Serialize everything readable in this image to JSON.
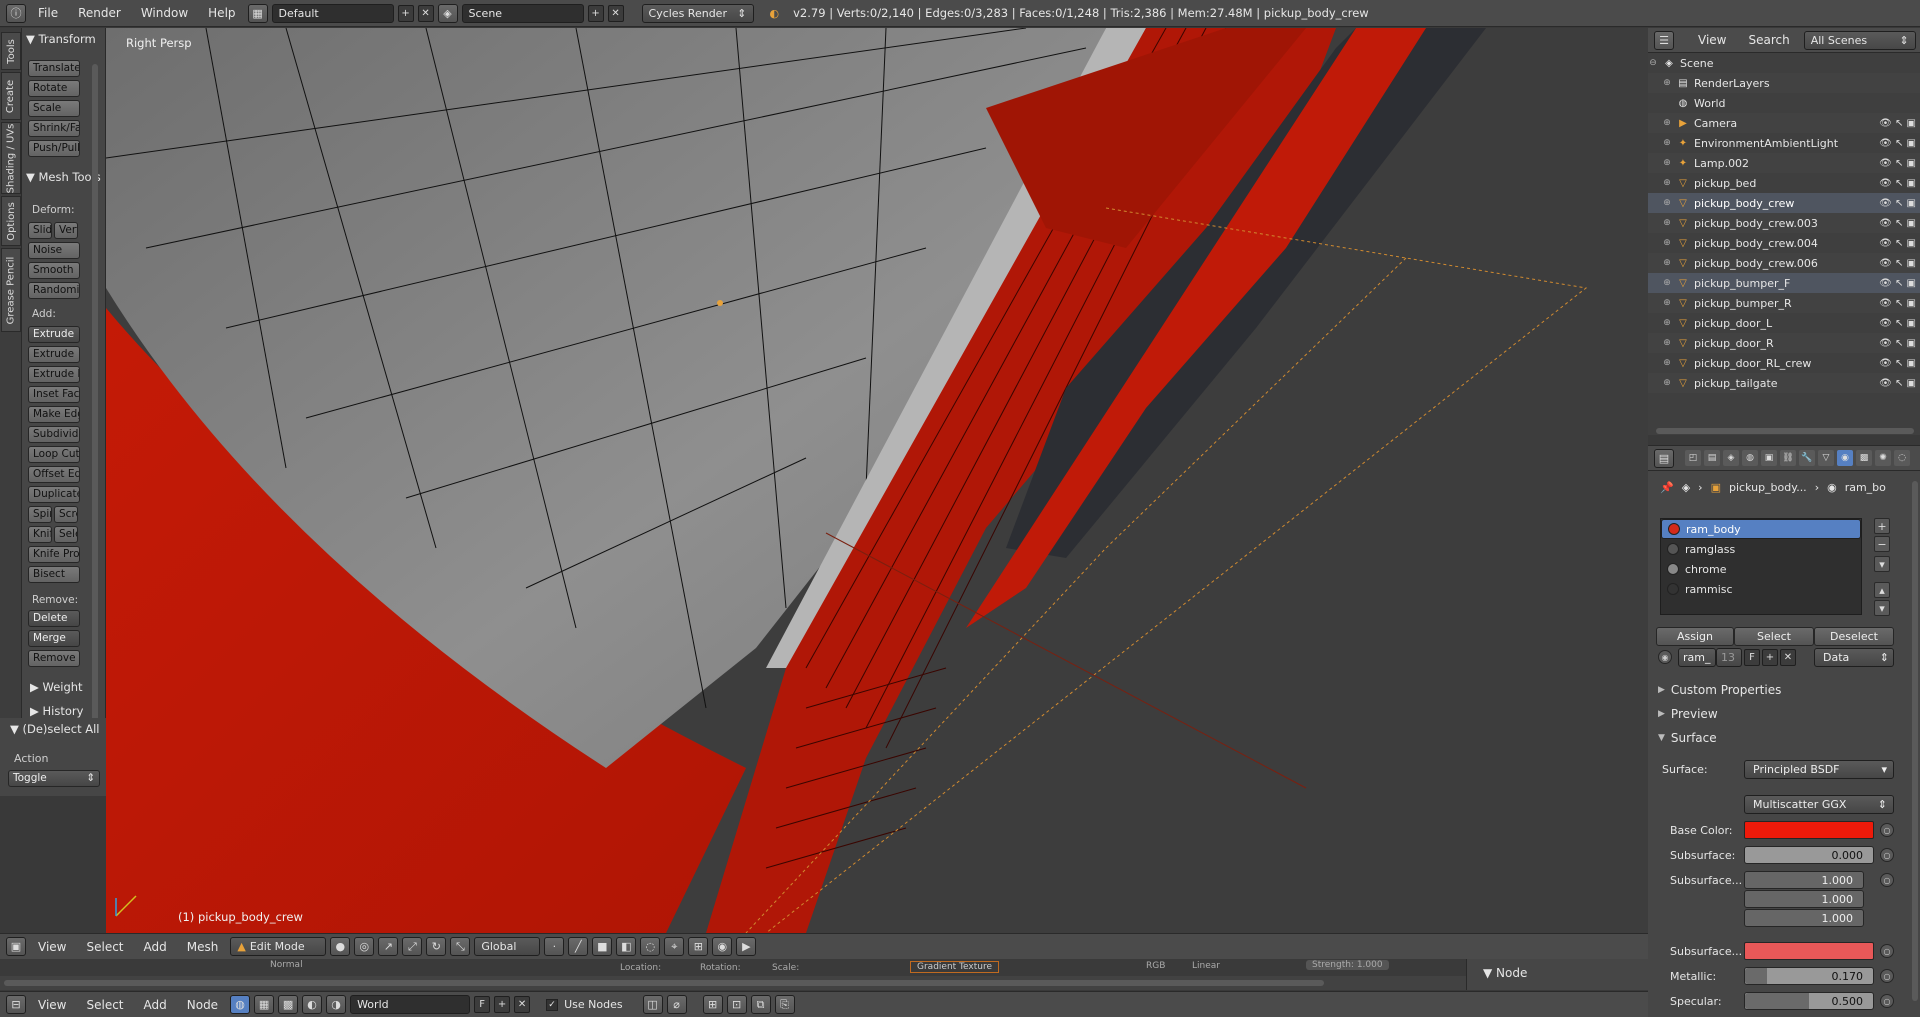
{
  "topbar": {
    "menus": [
      "File",
      "Render",
      "Window",
      "Help"
    ],
    "layout": "Default",
    "scene": "Scene",
    "engine": "Cycles Render",
    "stats": "v2.79 | Verts:0/2,140 | Edges:0/3,283 | Faces:0/1,248 | Tris:2,386 | Mem:27.48M | pickup_body_crew"
  },
  "tabs": [
    "Tools",
    "Create",
    "Shading / UVs",
    "Options",
    "Grease Pencil"
  ],
  "toolshelf": {
    "transform_header": "Transform",
    "transform_buttons": [
      "Translate",
      "Rotate",
      "Scale",
      "Shrink/Fatten",
      "Push/Pull"
    ],
    "meshtools_header": "Mesh Tools",
    "deform_label": "Deform:",
    "deform_buttons": [
      "Slide",
      "Vertex",
      "Noise",
      "Smooth",
      "Randomize"
    ],
    "add_label": "Add:",
    "add_buttons": [
      "Extrude",
      "Extrude",
      "Extrude Individual",
      "Inset Faces",
      "Make Edge/Face",
      "Subdivide",
      "Loop Cut and Slide",
      "Offset Edge Slide",
      "Duplicate",
      "Spin",
      "Screw",
      "Knife",
      "Select",
      "Knife Project",
      "Bisect"
    ],
    "remove_label": "Remove:",
    "remove_buttons": [
      "Delete",
      "Merge",
      "Remove"
    ],
    "weight_header": "Weight",
    "history_header": "History"
  },
  "operator_panel": {
    "header": "(De)select All",
    "action_label": "Action",
    "action_value": "Toggle"
  },
  "viewport": {
    "view_label": "Right Persp",
    "object_label": "(1) pickup_body_crew"
  },
  "view_header": {
    "menus": [
      "View",
      "Select",
      "Add",
      "Mesh"
    ],
    "mode": "Edit Mode",
    "orientation": "Global"
  },
  "node_strip": {
    "labels": [
      "Normal",
      "Location:",
      "Rotation:",
      "Scale:",
      "Gradient Texture",
      "RGB",
      "Linear",
      "Strength: 1.000"
    ],
    "panel": "Node"
  },
  "node_header": {
    "menus": [
      "View",
      "Select",
      "Add",
      "Node"
    ],
    "world": "World",
    "world_f": "F",
    "use_nodes": "Use Nodes"
  },
  "outliner": {
    "menus": [
      "View",
      "Search"
    ],
    "filter": "All Scenes",
    "items": [
      {
        "label": "Scene",
        "icon": "scene-icon"
      },
      {
        "label": "RenderLayers",
        "icon": "renderlayers-icon"
      },
      {
        "label": "World",
        "icon": "world-icon"
      },
      {
        "label": "Camera",
        "icon": "camera-icon"
      },
      {
        "label": "EnvironmentAmbientLight",
        "icon": "lamp-icon"
      },
      {
        "label": "Lamp.002",
        "icon": "lamp-icon"
      },
      {
        "label": "pickup_bed",
        "icon": "mesh-icon"
      },
      {
        "label": "pickup_body_crew",
        "icon": "mesh-icon"
      },
      {
        "label": "pickup_body_crew.003",
        "icon": "mesh-icon"
      },
      {
        "label": "pickup_body_crew.004",
        "icon": "mesh-icon"
      },
      {
        "label": "pickup_body_crew.006",
        "icon": "mesh-icon"
      },
      {
        "label": "pickup_bumper_F",
        "icon": "mesh-icon"
      },
      {
        "label": "pickup_bumper_R",
        "icon": "mesh-icon"
      },
      {
        "label": "pickup_door_L",
        "icon": "mesh-icon"
      },
      {
        "label": "pickup_door_R",
        "icon": "mesh-icon"
      },
      {
        "label": "pickup_door_RL_crew",
        "icon": "mesh-icon"
      },
      {
        "label": "pickup_tailgate",
        "icon": "mesh-icon"
      }
    ]
  },
  "properties": {
    "breadcrumb": [
      "pickup_body...",
      "ram_bo"
    ],
    "materials": [
      {
        "name": "ram_body",
        "color": "#d42a1a"
      },
      {
        "name": "ramglass",
        "color": "#555555"
      },
      {
        "name": "chrome",
        "color": "#888888"
      },
      {
        "name": "rammisc",
        "color": "#333333"
      }
    ],
    "assign": "Assign",
    "select": "Select",
    "deselect": "Deselect",
    "mat_name": "ram_",
    "mat_users": "13",
    "mat_f": "F",
    "link": "Data",
    "sections": [
      "Custom Properties",
      "Preview",
      "Surface"
    ],
    "surface_label": "Surface:",
    "surface_value": "Principled BSDF",
    "distribution": "Multiscatter GGX",
    "base_color_label": "Base Color:",
    "base_color": "#ee1a0a",
    "subsurface_label": "Subsurface:",
    "subsurface_value": "0.000",
    "subsurface_radius_label": "Subsurface...",
    "radius": [
      "1.000",
      "1.000",
      "1.000"
    ],
    "subsurface_color_label": "Subsurface...",
    "subsurface_color": "#e85858",
    "metallic_label": "Metallic:",
    "metallic_value": "0.170",
    "specular_label": "Specular:",
    "specular_value": "0.500"
  }
}
